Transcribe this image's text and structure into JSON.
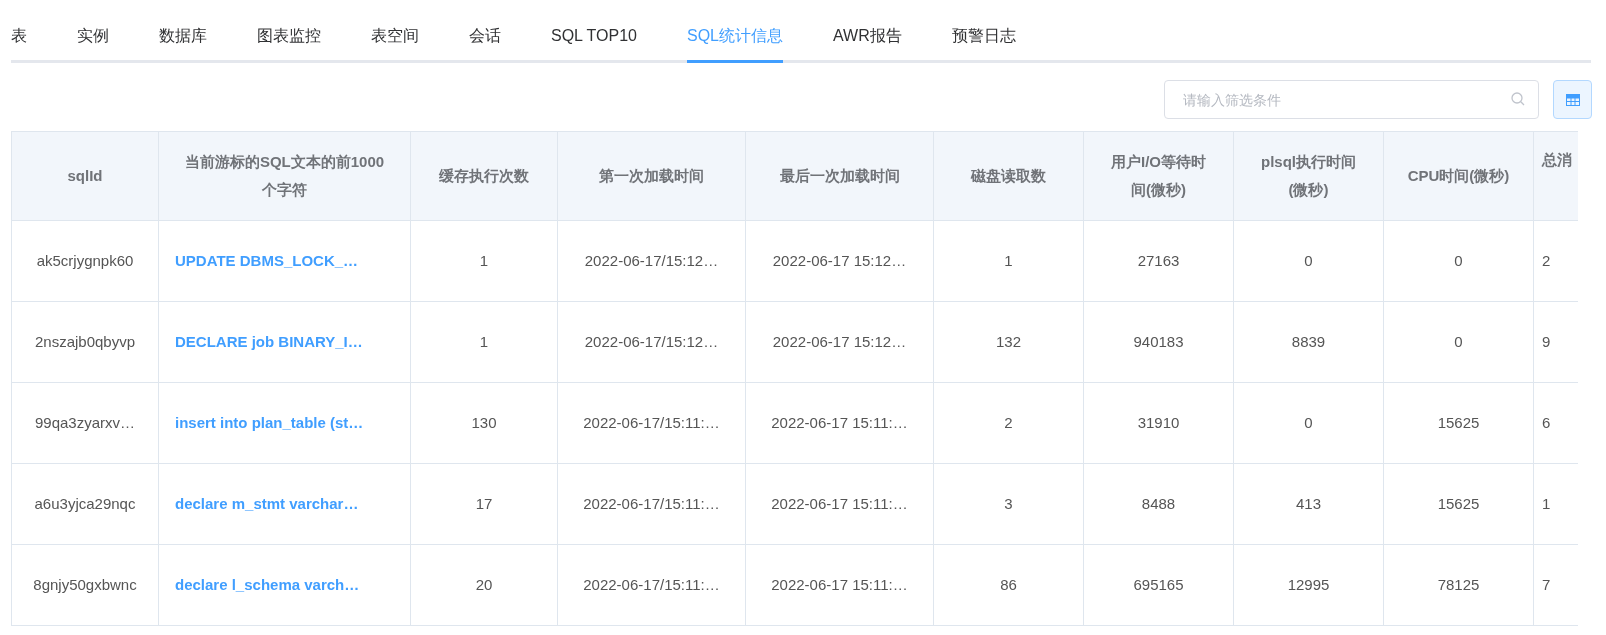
{
  "tabs": [
    {
      "label": "表",
      "selected": false
    },
    {
      "label": "实例",
      "selected": false
    },
    {
      "label": "数据库",
      "selected": false
    },
    {
      "label": "图表监控",
      "selected": false
    },
    {
      "label": "表空间",
      "selected": false
    },
    {
      "label": "会话",
      "selected": false
    },
    {
      "label": "SQL TOP10",
      "selected": false
    },
    {
      "label": "SQL统计信息",
      "selected": true
    },
    {
      "label": "AWR报告",
      "selected": false
    },
    {
      "label": "预警日志",
      "selected": false
    }
  ],
  "search": {
    "placeholder": "请输入筛选条件"
  },
  "table": {
    "columns": [
      "sqlId",
      "当前游标的SQL文本的前1000个字符",
      "缓存执行次数",
      "第一次加载时间",
      "最后一次加载时间",
      "磁盘读取数",
      "用户I/O等待时间(微秒)",
      "plsql执行时间(微秒)",
      "CPU时间(微秒)",
      "总消"
    ],
    "rows": [
      [
        "ak5crjygnpk60",
        "UPDATE DBMS_LOCK_…",
        "1",
        "2022-06-17/15:12…",
        "2022-06-17 15:12…",
        "1",
        "27163",
        "0",
        "0",
        "2"
      ],
      [
        "2nszajb0qbyvp",
        "DECLARE job BINARY_I…",
        "1",
        "2022-06-17/15:12…",
        "2022-06-17 15:12…",
        "132",
        "940183",
        "8839",
        "0",
        "9"
      ],
      [
        "99qa3zyarxv…",
        "insert into plan_table (st…",
        "130",
        "2022-06-17/15:11:…",
        "2022-06-17 15:11:…",
        "2",
        "31910",
        "0",
        "15625",
        "6"
      ],
      [
        "a6u3yjca29nqc",
        "declare m_stmt varchar…",
        "17",
        "2022-06-17/15:11:…",
        "2022-06-17 15:11:…",
        "3",
        "8488",
        "413",
        "15625",
        "1"
      ],
      [
        "8gnjy50gxbwnc",
        "declare l_schema varch…",
        "20",
        "2022-06-17/15:11:…",
        "2022-06-17 15:11:…",
        "86",
        "695165",
        "12995",
        "78125",
        "7"
      ]
    ]
  }
}
